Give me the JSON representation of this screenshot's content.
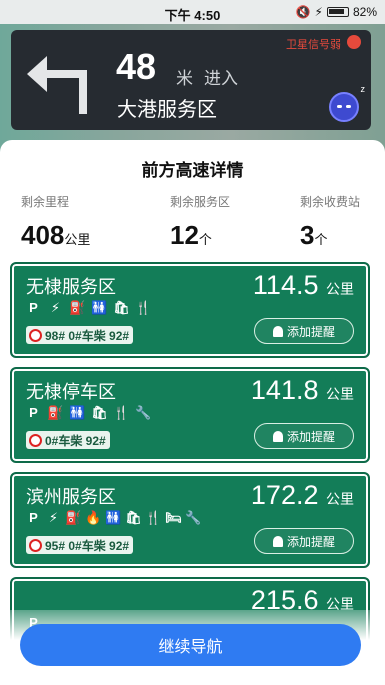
{
  "status": {
    "time": "下午 4:50",
    "battery": "82%"
  },
  "nav": {
    "distance": "48",
    "distance_unit": "米",
    "action": "进入",
    "target": "大港服务区",
    "gps_status": "卫星信号弱"
  },
  "sheet": {
    "title": "前方高速详情",
    "stats": [
      {
        "label": "剩余里程",
        "value": "408",
        "unit": "公里"
      },
      {
        "label": "剩余服务区",
        "value": "12",
        "unit": "个"
      },
      {
        "label": "剩余收费站",
        "value": "3",
        "unit": "个"
      }
    ]
  },
  "areas": [
    {
      "name": "无棣服务区",
      "distance": "114.5",
      "unit": "公里",
      "fuel": "98# 0#车柴 92#",
      "remind": "添加提醒",
      "amenities": [
        "parking-icon",
        "charging-icon",
        "fuel-icon",
        "restroom-icon",
        "shop-icon",
        "restaurant-icon"
      ]
    },
    {
      "name": "无棣停车区",
      "distance": "141.8",
      "unit": "公里",
      "fuel": "0#车柴 92#",
      "remind": "添加提醒",
      "amenities": [
        "parking-icon",
        "fuel-icon",
        "restroom-icon",
        "shop-icon",
        "restaurant-icon",
        "repair-icon"
      ]
    },
    {
      "name": "滨州服务区",
      "distance": "172.2",
      "unit": "公里",
      "fuel": "95# 0#车柴 92#",
      "remind": "添加提醒",
      "amenities": [
        "parking-icon",
        "charging-icon",
        "fuel-icon",
        "gas-icon",
        "restroom-icon",
        "shop-icon",
        "restaurant-icon",
        "hotel-icon",
        "repair-icon"
      ]
    },
    {
      "distance": "215.6",
      "unit": "公里"
    }
  ],
  "continue_label": "继续导航"
}
